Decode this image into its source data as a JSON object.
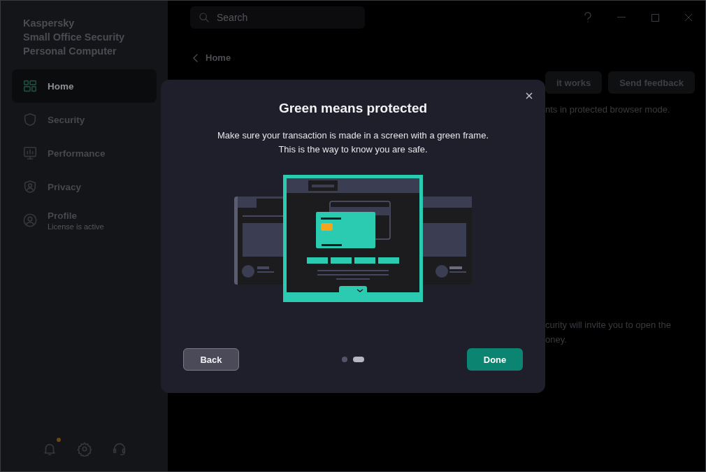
{
  "sidebar": {
    "brand": [
      "Kaspersky",
      "Small Office Security",
      "Personal Computer"
    ],
    "nav": [
      {
        "label": "Home",
        "selected": true
      },
      {
        "label": "Security",
        "selected": false
      },
      {
        "label": "Performance",
        "selected": false
      },
      {
        "label": "Privacy",
        "selected": false
      },
      {
        "label": "Profile",
        "subtitle": "License is active",
        "selected": false
      }
    ],
    "has_notification": true
  },
  "search": {
    "placeholder": "Search"
  },
  "breadcrumb": "Home",
  "header_buttons": [
    "it works",
    "Send feedback"
  ],
  "background_text": [
    "nts in protected browser mode.",
    "curity will invite you to open the",
    "oney."
  ],
  "dialog": {
    "title": "Green means protected",
    "description": [
      "Make sure your transaction is made in a screen with a green frame.",
      "This is the way to know you are safe."
    ],
    "pages": [
      {
        "selected": false
      },
      {
        "selected": true
      }
    ],
    "back": "Back",
    "done": "Done"
  }
}
